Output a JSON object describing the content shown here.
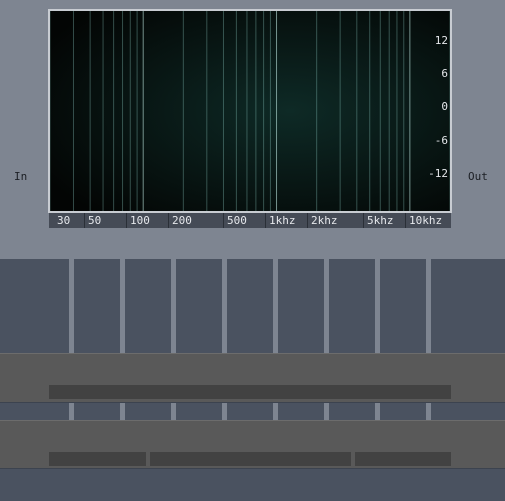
{
  "labels": {
    "in": "In",
    "out": "Out"
  },
  "freq_axis": [
    "30",
    "50",
    "100",
    "200",
    "500",
    "1khz",
    "2khz",
    "5khz",
    "10khz"
  ],
  "db_axis": [
    "12",
    "6",
    "0",
    "-6",
    "-12"
  ],
  "colors": {
    "background_top": "#7e8591",
    "panel": "#4a5260",
    "plot": "#050807",
    "trace": "#4fd6c4"
  }
}
